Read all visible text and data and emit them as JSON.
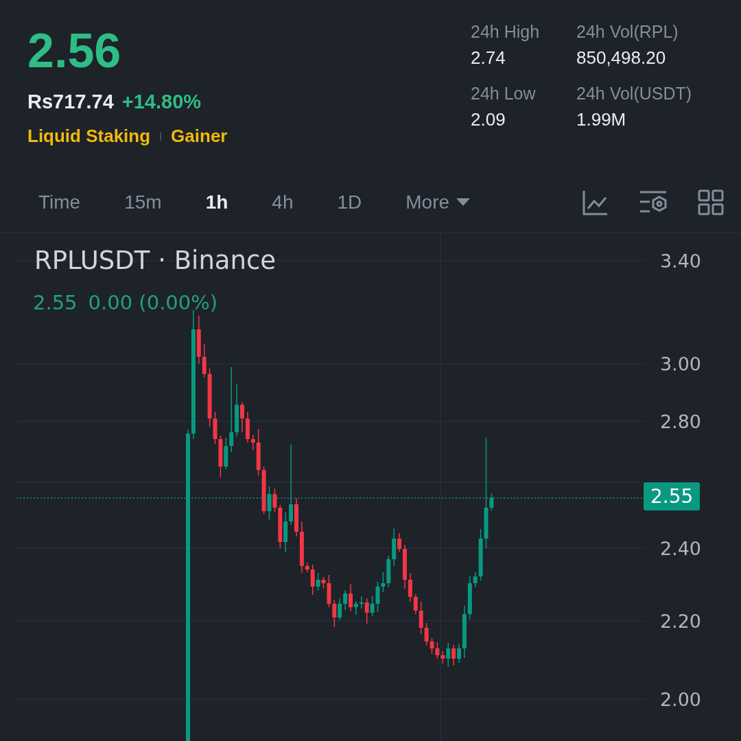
{
  "ticker": {
    "price": "2.56",
    "fiat_price": "Rs717.74",
    "change": "+14.80%",
    "tags": [
      "Liquid Staking",
      "Gainer"
    ]
  },
  "stats": [
    {
      "label": "24h High",
      "value": "2.74"
    },
    {
      "label": "24h Vol(RPL)",
      "value": "850,498.20"
    },
    {
      "label": "24h Low",
      "value": "2.09"
    },
    {
      "label": "24h Vol(USDT)",
      "value": "1.99M"
    }
  ],
  "intervals": [
    {
      "label": "Time",
      "selected": false,
      "kind": "plain"
    },
    {
      "label": "15m",
      "selected": false,
      "kind": "plain"
    },
    {
      "label": "1h",
      "selected": true,
      "kind": "plain"
    },
    {
      "label": "4h",
      "selected": false,
      "kind": "plain"
    },
    {
      "label": "1D",
      "selected": false,
      "kind": "plain"
    },
    {
      "label": "More",
      "selected": false,
      "kind": "dropdown"
    }
  ],
  "chart": {
    "symbol": "RPLUSDT · Binance",
    "legend": [
      "2.55",
      "0.00 (0.00%)"
    ],
    "price_axis": [
      "3.40",
      "3.00",
      "2.80",
      "2.40",
      "2.20",
      "2.00"
    ],
    "last_price": "2.55"
  }
}
